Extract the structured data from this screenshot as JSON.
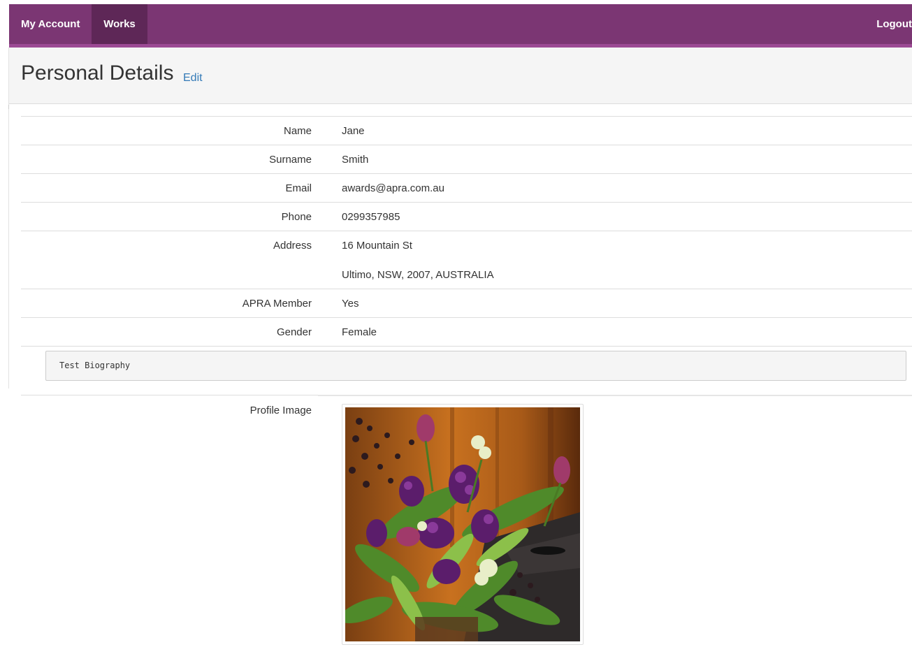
{
  "nav": {
    "my_account": "My Account",
    "works": "Works",
    "logout": "Logout"
  },
  "header": {
    "title": "Personal Details",
    "edit": "Edit"
  },
  "details": {
    "name_label": "Name",
    "name_value": "Jane",
    "surname_label": "Surname",
    "surname_value": "Smith",
    "email_label": "Email",
    "email_value": "awards@apra.com.au",
    "phone_label": "Phone",
    "phone_value": "0299357985",
    "address_label": "Address",
    "address_line1": "16 Mountain St",
    "address_line2": "Ultimo, NSW, 2007, AUSTRALIA",
    "member_label": "APRA Member",
    "member_value": "Yes",
    "gender_label": "Gender",
    "gender_value": "Female"
  },
  "biography": "Test Biography",
  "profile": {
    "label": "Profile Image"
  },
  "colors": {
    "navbar": "#7b3673",
    "navbar_active": "#5e2757",
    "link": "#337ab7"
  }
}
